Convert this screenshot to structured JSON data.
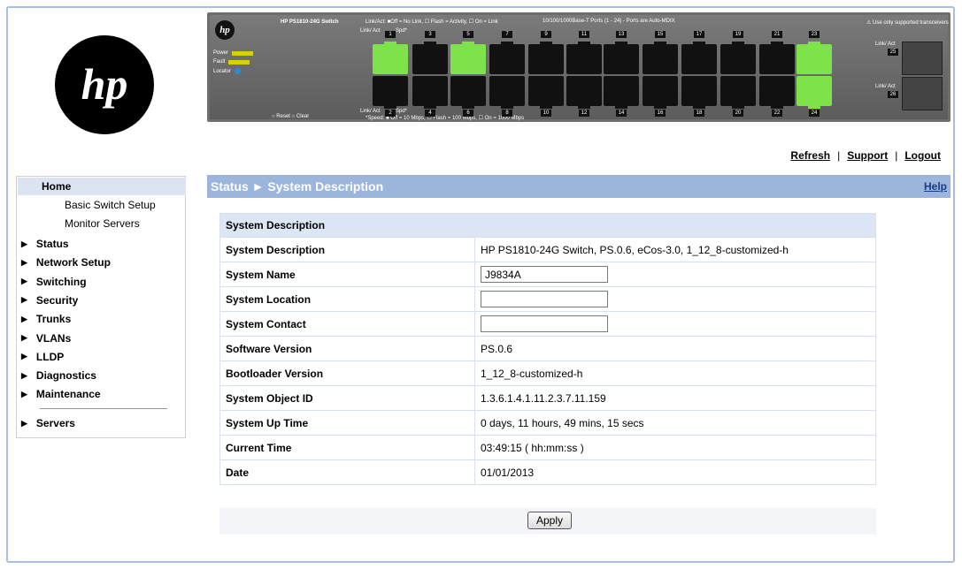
{
  "brand": {
    "logo": "hp"
  },
  "panel": {
    "model": "HP PS1810-24G Switch",
    "legend_link": "Link/Act: ■Off = No Link, ☐ Flash = Activity, ☐ On = Link",
    "ports_note": "10/100/1000Base-T Ports (1 - 24) - Ports are Auto-MDIX",
    "transceiver_note": "⚠ Use only supported transceivers",
    "speed_note": "*Speed: ■ Off = 10 Mbps, ☐ Flash = 100 Mbps, ☐ On = 1000 Mbps",
    "power": "Power",
    "fault": "Fault",
    "locator": "Locator",
    "reset": "○ Reset ○ Clear",
    "link_act": "Link/ Act",
    "spd": "Spd*",
    "ports_top": [
      "1",
      "3",
      "5",
      "7",
      "9",
      "11",
      "13",
      "15",
      "17",
      "19",
      "21",
      "23"
    ],
    "ports_bottom": [
      "2",
      "4",
      "6",
      "8",
      "10",
      "12",
      "14",
      "16",
      "18",
      "20",
      "22",
      "24"
    ],
    "sfp_ports": [
      "25",
      "26"
    ],
    "active_ports": [
      "1",
      "5",
      "23",
      "24"
    ]
  },
  "toplinks": {
    "refresh": "Refresh",
    "support": "Support",
    "logout": "Logout"
  },
  "nav": {
    "home": "Home",
    "sub": [
      "Basic Switch Setup",
      "Monitor Servers"
    ],
    "items": [
      "Status",
      "Network Setup",
      "Switching",
      "Security",
      "Trunks",
      "VLANs",
      "LLDP",
      "Diagnostics",
      "Maintenance"
    ],
    "servers": "Servers"
  },
  "header": {
    "title": "Status ► System Description",
    "help": "Help"
  },
  "table": {
    "title": "System Description",
    "rows": [
      {
        "label": "System Description",
        "value": "HP PS1810-24G Switch, PS.0.6, eCos-3.0, 1_12_8-customized-h"
      },
      {
        "label": "System Name",
        "value": "J9834A"
      },
      {
        "label": "System Location",
        "value": ""
      },
      {
        "label": "System Contact",
        "value": ""
      },
      {
        "label": "Software Version",
        "value": "PS.0.6"
      },
      {
        "label": "Bootloader Version",
        "value": "1_12_8-customized-h"
      },
      {
        "label": "System Object ID",
        "value": "1.3.6.1.4.1.11.2.3.7.11.159"
      },
      {
        "label": "System Up Time",
        "value": "0 days, 11 hours, 49 mins, 15 secs"
      },
      {
        "label": "Current Time",
        "value": "03:49:15 ( hh:mm:ss )"
      },
      {
        "label": "Date",
        "value": "01/01/2013"
      }
    ]
  },
  "apply": "Apply",
  "colors": {
    "header": "#9cb5dc",
    "nav_highlight": "#dce4f2",
    "port_active": "#7ee24a",
    "frame": "#a9bde0"
  }
}
